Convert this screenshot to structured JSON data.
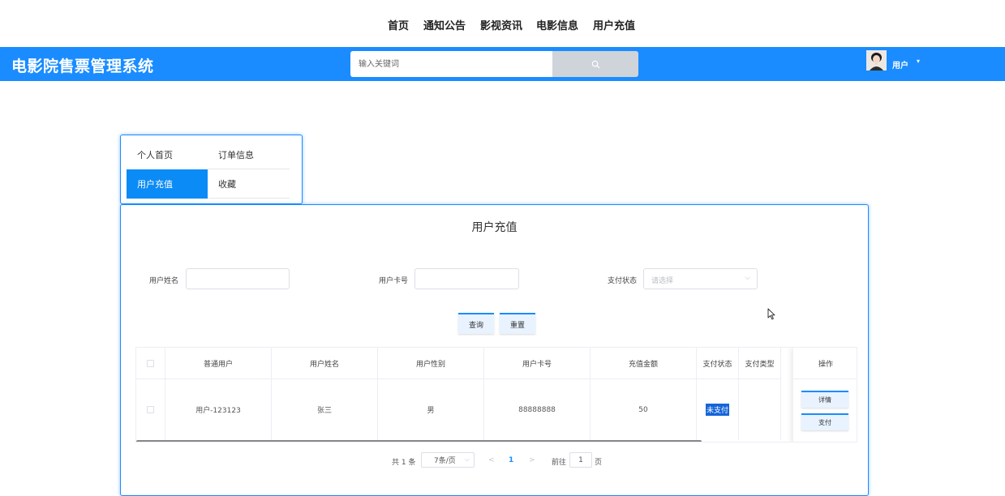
{
  "topnav": {
    "items": [
      "首页",
      "通知公告",
      "影视资讯",
      "电影信息",
      "用户充值"
    ]
  },
  "header": {
    "brand": "电影院售票管理系统",
    "search_placeholder": "输入关键词",
    "user_label": "用户",
    "accent_color": "#1a8cff"
  },
  "sidebar": {
    "tabs": [
      "个人首页",
      "订单信息",
      "用户充值",
      "收藏"
    ],
    "active": "用户充值"
  },
  "panel": {
    "title": "用户充值"
  },
  "filters": {
    "name_label": "用户姓名",
    "name_value": "",
    "card_label": "用户卡号",
    "card_value": "",
    "status_label": "支付状态",
    "status_placeholder": "请选择",
    "query_button": "查询",
    "reset_button": "重置"
  },
  "table": {
    "columns": [
      "普通用户",
      "用户姓名",
      "用户性别",
      "用户卡号",
      "充值金额",
      "支付状态",
      "支付类型",
      "操作"
    ],
    "rows": [
      {
        "user": "用户-123123",
        "name": "张三",
        "gender": "男",
        "card": "88888888",
        "amount": "50",
        "status": "未支付",
        "type": "",
        "actions": [
          "详情",
          "支付"
        ]
      }
    ]
  },
  "pagination": {
    "total": "共 1 条",
    "page_size": "7条/页",
    "prev": "<",
    "current_page": "1",
    "next": ">",
    "goto_label": "前往",
    "goto_value": "1",
    "page_unit": "页"
  }
}
